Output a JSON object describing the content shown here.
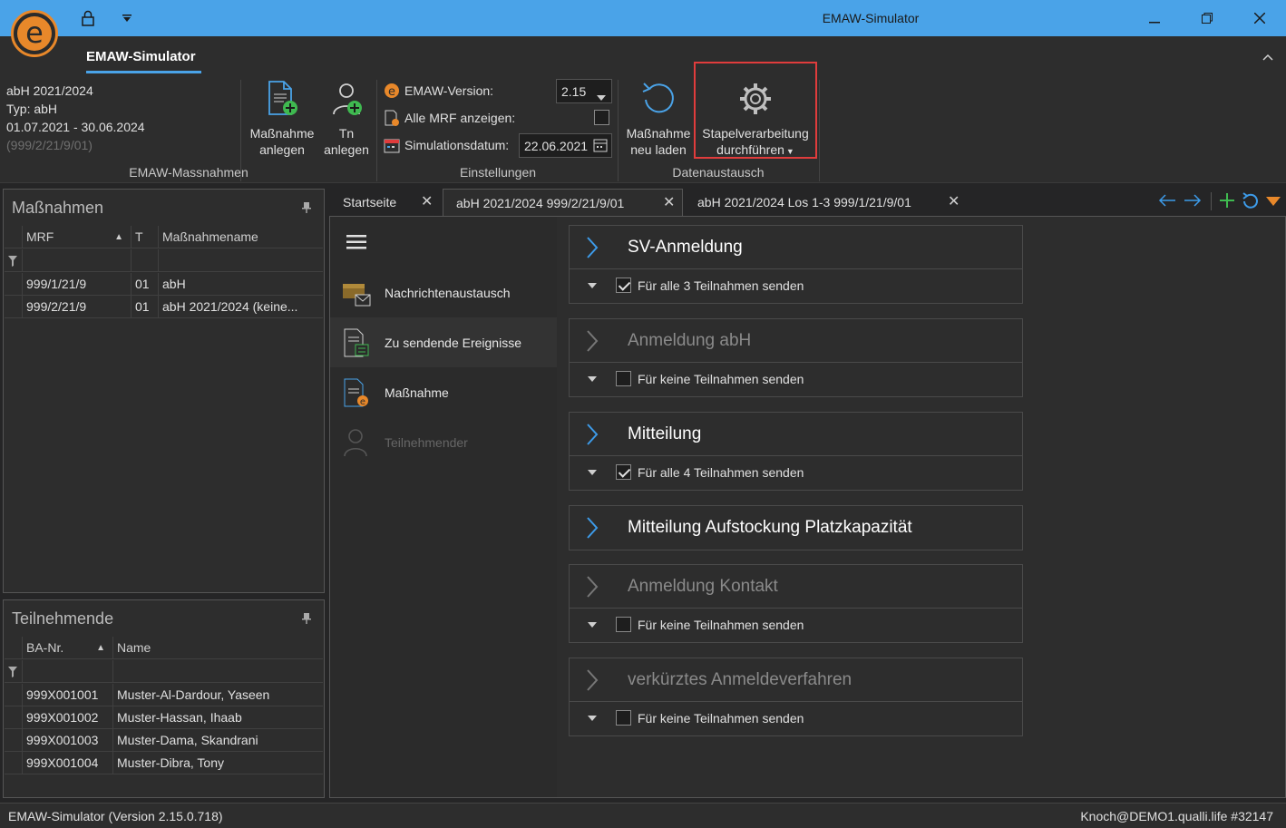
{
  "window": {
    "title": "EMAW-Simulator",
    "logo_letter": "e"
  },
  "ribbon": {
    "tab": "EMAW-Simulator",
    "info": {
      "line1": "abH 2021/2024",
      "line2": "Typ: abH",
      "line3": "01.07.2021 - 30.06.2024",
      "line4": "(999/2/21/9/01)"
    },
    "group1_label": "EMAW-Massnahmen",
    "btn_massnahme_anlegen": [
      "Maßnahme",
      "anlegen"
    ],
    "btn_tn_anlegen": [
      "Tn",
      "anlegen"
    ],
    "group2_label": "Einstellungen",
    "emaw_version_label": "EMAW-Version:",
    "emaw_version_value": "2.15",
    "alle_mrf_label": "Alle MRF anzeigen:",
    "alle_mrf_checked": false,
    "simulationsdatum_label": "Simulationsdatum:",
    "simulationsdatum_value": "22.06.2021",
    "group3_label": "Datenaustausch",
    "btn_neu_laden": [
      "Maßnahme",
      "neu laden"
    ],
    "btn_stapel": [
      "Stapelverarbeitung",
      "durchführen"
    ]
  },
  "massnahmen_panel": {
    "title": "Maßnahmen",
    "columns": [
      "MRF",
      "T",
      "Maßnahmename"
    ],
    "rows": [
      [
        "999/1/21/9",
        "01",
        "abH"
      ],
      [
        "999/2/21/9",
        "01",
        "abH 2021/2024 (keine..."
      ]
    ]
  },
  "teilnehmende_panel": {
    "title": "Teilnehmende",
    "columns": [
      "BA-Nr.",
      "Name"
    ],
    "rows": [
      [
        "999X001001",
        "Muster-Al-Dardour, Yaseen"
      ],
      [
        "999X001002",
        "Muster-Hassan, Ihaab"
      ],
      [
        "999X001003",
        "Muster-Dama, Skandrani"
      ],
      [
        "999X001004",
        "Muster-Dibra, Tony"
      ]
    ]
  },
  "tabs": [
    {
      "label": "Startseite"
    },
    {
      "label": "abH 2021/2024 999/2/21/9/01"
    },
    {
      "label": "abH 2021/2024 Los 1-3 999/1/21/9/01"
    }
  ],
  "nav": [
    {
      "label": "Nachrichtenaustausch",
      "icon": "mail-icon"
    },
    {
      "label": "Zu sendende Ereignisse",
      "icon": "document-list-icon"
    },
    {
      "label": "Maßnahme",
      "icon": "document-e-icon"
    },
    {
      "label": "Teilnehmender",
      "icon": "person-icon"
    }
  ],
  "events": [
    {
      "name": "SV-Anmeldung",
      "active": true,
      "sub": "Für alle 3 Teilnahmen senden",
      "checked": true
    },
    {
      "name": "Anmeldung abH",
      "active": false,
      "sub": "Für keine Teilnahmen senden",
      "checked": false
    },
    {
      "name": "Mitteilung",
      "active": true,
      "sub": "Für alle 4 Teilnahmen senden",
      "checked": true
    },
    {
      "name": "Mitteilung Aufstockung Platzkapazität",
      "active": true,
      "sub": null,
      "checked": false
    },
    {
      "name": "Anmeldung Kontakt",
      "active": false,
      "sub": "Für keine Teilnahmen senden",
      "checked": false
    },
    {
      "name": "verkürztes Anmeldeverfahren",
      "active": false,
      "sub": "Für keine Teilnahmen senden",
      "checked": false
    }
  ],
  "status": {
    "left": "EMAW-Simulator (Version 2.15.0.718)",
    "right": "Knoch@DEMO1.qualli.life  #32147"
  },
  "colors": {
    "titlebar": "#4aa3e8",
    "accent_orange": "#e8882a",
    "highlight_red": "#e03c3c",
    "chevron_blue": "#3d9be9"
  }
}
